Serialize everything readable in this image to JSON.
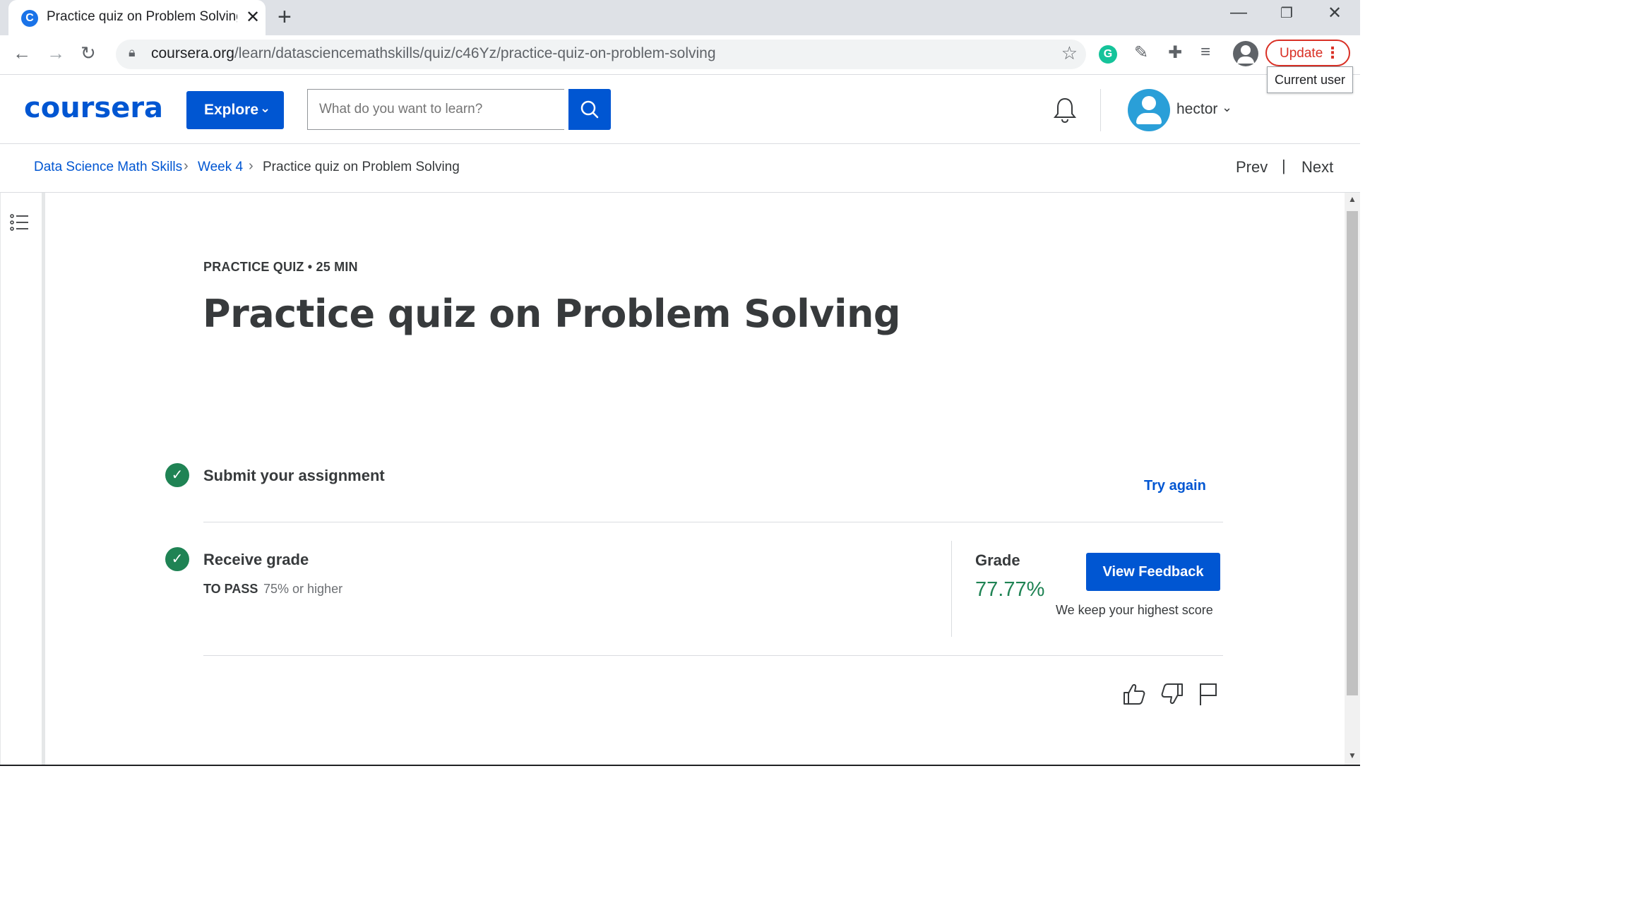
{
  "browser": {
    "tab_title": "Practice quiz on Problem Solving",
    "tab_favicon": "C",
    "new_tab": "+",
    "url_host": "coursera.org",
    "url_path": "/learn/datasciencemathskills/quiz/c46Yz/practice-quiz-on-problem-solving",
    "update_label": "Update",
    "tooltip": "Current user",
    "icons": [
      "back-icon",
      "forward-icon",
      "reload-icon",
      "lock-icon",
      "star-icon",
      "grammarly-icon",
      "eyedropper-icon",
      "puzzle-icon",
      "media-icon",
      "profile-icon",
      "more-icon",
      "minimize-icon",
      "restore-icon",
      "close-icon"
    ]
  },
  "header": {
    "logo": "coursera",
    "explore_label": "Explore",
    "search_placeholder": "What do you want to learn?",
    "username": "hector",
    "brand_color": "#0056d2"
  },
  "breadcrumb": {
    "items": [
      "Data Science Math Skills",
      "Week 4",
      "Practice quiz on Problem Solving"
    ],
    "prev": "Prev",
    "pipe": "|",
    "next": "Next"
  },
  "quiz": {
    "kicker": "PRACTICE QUIZ • 25 MIN",
    "title": "Practice quiz on Problem Solving",
    "step1_title": "Submit your assignment",
    "try_again": "Try again",
    "step2_title": "Receive grade",
    "to_pass_label": "TO PASS",
    "to_pass_value": "75% or higher",
    "grade_label": "Grade",
    "grade_value": "77.77%",
    "view_feedback": "View Feedback",
    "highest_note": "We keep your highest score",
    "success_color": "#1f8354"
  }
}
